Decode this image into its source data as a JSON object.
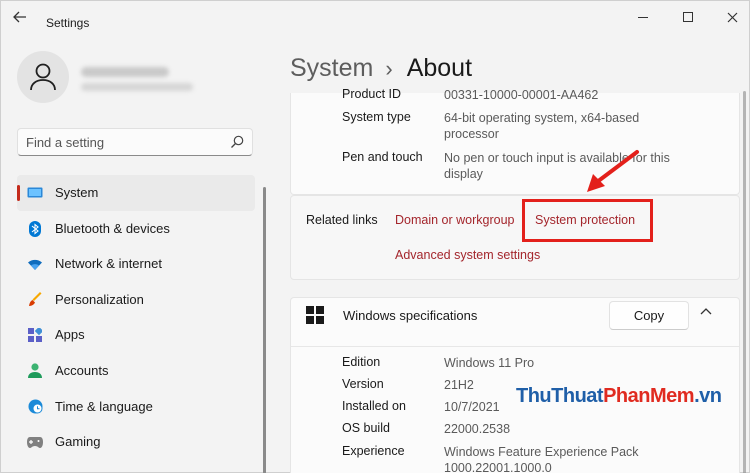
{
  "window": {
    "title": "Settings"
  },
  "profile": {
    "name": "",
    "email": ""
  },
  "search": {
    "placeholder": "Find a setting"
  },
  "sidebar": {
    "items": [
      {
        "label": "System",
        "icon": "monitor-icon",
        "active": true
      },
      {
        "label": "Bluetooth & devices",
        "icon": "bluetooth-icon"
      },
      {
        "label": "Network & internet",
        "icon": "wifi-icon"
      },
      {
        "label": "Personalization",
        "icon": "brush-icon"
      },
      {
        "label": "Apps",
        "icon": "apps-icon"
      },
      {
        "label": "Accounts",
        "icon": "person-icon"
      },
      {
        "label": "Time & language",
        "icon": "globe-clock-icon"
      },
      {
        "label": "Gaming",
        "icon": "gamepad-icon"
      }
    ]
  },
  "header": {
    "parent": "System",
    "separator": "›",
    "current": "About"
  },
  "device_specs": {
    "rows": [
      {
        "key": "Product ID",
        "value": "00331-10000-00001-AA462"
      },
      {
        "key": "System type",
        "value": "64-bit operating system, x64-based processor"
      },
      {
        "key": "Pen and touch",
        "value": "No pen or touch input is available for this display"
      }
    ]
  },
  "related_links": {
    "label": "Related links",
    "domain": "Domain or workgroup",
    "protection": "System protection",
    "advanced": "Advanced system settings"
  },
  "windows_specs": {
    "title": "Windows specifications",
    "copy_label": "Copy",
    "rows": [
      {
        "key": "Edition",
        "value": "Windows 11 Pro"
      },
      {
        "key": "Version",
        "value": "21H2"
      },
      {
        "key": "Installed on",
        "value": "10/7/2021"
      },
      {
        "key": "OS build",
        "value": "22000.2538"
      },
      {
        "key": "Experience",
        "value": "Windows Feature Experience Pack 1000.22001.1000.0"
      }
    ]
  },
  "watermark": {
    "part1": "ThuThuat",
    "part2": "PhanMem",
    "part3": ".vn"
  },
  "colors": {
    "accent": "#c42b1c",
    "link": "#a4262c",
    "highlight": "#e3201b"
  }
}
